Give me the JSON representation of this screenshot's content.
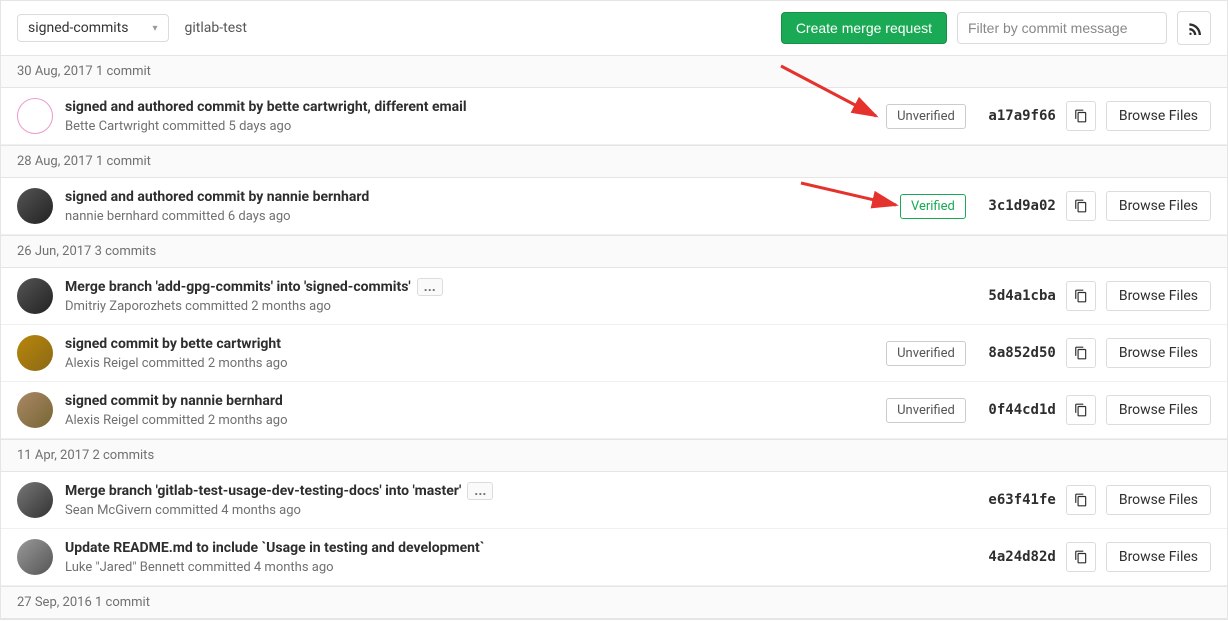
{
  "branch": "signed-commits",
  "repo": "gitlab-test",
  "create_mr_label": "Create merge request",
  "filter_placeholder": "Filter by commit message",
  "browse_label": "Browse Files",
  "verified_label": "Verified",
  "unverified_label": "Unverified",
  "groups": [
    {
      "header": "30 Aug, 2017 1 commit",
      "commits": [
        {
          "title": "signed and authored commit by bette cartwright, different email",
          "meta": "Bette Cartwright committed 5 days ago",
          "status": "unverified",
          "sha": "a17a9f66",
          "more": false,
          "av": "av-a"
        }
      ]
    },
    {
      "header": "28 Aug, 2017 1 commit",
      "commits": [
        {
          "title": "signed and authored commit by nannie bernhard",
          "meta": "nannie bernhard committed 6 days ago",
          "status": "verified",
          "sha": "3c1d9a02",
          "more": false,
          "av": "av-b"
        }
      ]
    },
    {
      "header": "26 Jun, 2017 3 commits",
      "commits": [
        {
          "title": "Merge branch 'add-gpg-commits' into 'signed-commits'",
          "meta": "Dmitriy Zaporozhets committed 2 months ago",
          "status": null,
          "sha": "5d4a1cba",
          "more": true,
          "av": "av-b"
        },
        {
          "title": "signed commit by bette cartwright",
          "meta": "Alexis Reigel committed 2 months ago",
          "status": "unverified",
          "sha": "8a852d50",
          "more": false,
          "av": "av-c"
        },
        {
          "title": "signed commit by nannie bernhard",
          "meta": "Alexis Reigel committed 2 months ago",
          "status": "unverified",
          "sha": "0f44cd1d",
          "more": false,
          "av": "av-d"
        }
      ]
    },
    {
      "header": "11 Apr, 2017 2 commits",
      "commits": [
        {
          "title": "Merge branch 'gitlab-test-usage-dev-testing-docs' into 'master'",
          "meta": "Sean McGivern committed 4 months ago",
          "status": null,
          "sha": "e63f41fe",
          "more": true,
          "av": "av-e"
        },
        {
          "title": "Update README.md to include `Usage in testing and development`",
          "meta": "Luke \"Jared\" Bennett committed 4 months ago",
          "status": null,
          "sha": "4a24d82d",
          "more": false,
          "av": "av-f"
        }
      ]
    },
    {
      "header": "27 Sep, 2016 1 commit",
      "commits": []
    }
  ]
}
